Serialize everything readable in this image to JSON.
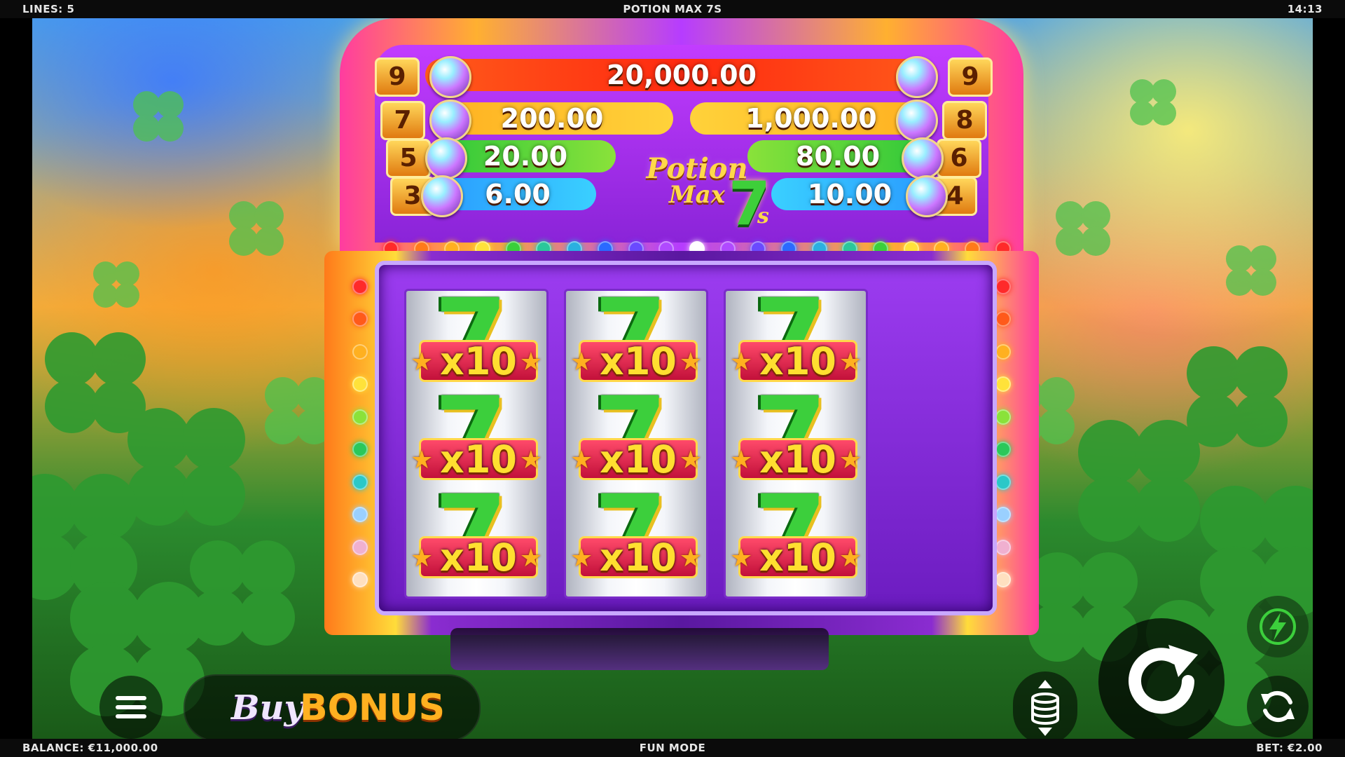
{
  "status_bar": {
    "lines_label": "LINES: 5",
    "game_title": "POTION MAX 7S",
    "clock": "14:13",
    "balance": "BALANCE: €11,000.00",
    "mode": "FUN MODE",
    "bet": "BET: €2.00"
  },
  "paytable": {
    "rows": [
      {
        "left_count": "9",
        "right_count": "9",
        "center_value": "20,000.00"
      },
      {
        "left_count": "7",
        "left_value": "200.00",
        "right_value": "1,000.00",
        "right_count": "8"
      },
      {
        "left_count": "5",
        "left_value": "20.00",
        "right_value": "80.00",
        "right_count": "6"
      },
      {
        "left_count": "3",
        "left_value": "6.00",
        "right_value": "10.00",
        "right_count": "4"
      }
    ]
  },
  "logo": {
    "line1": "Potion",
    "line2": "Max",
    "seven": "7",
    "suffix": "s"
  },
  "reels": {
    "symbol_multiplier": "x10",
    "grid": [
      [
        "x10",
        "x10",
        "x10"
      ],
      [
        "x10",
        "x10",
        "x10"
      ],
      [
        "x10",
        "x10",
        "x10"
      ]
    ]
  },
  "controls": {
    "buy_label": "Buy",
    "bonus_label": "BONUS"
  },
  "colors": {
    "accent_orange": "#ffb020",
    "seven_green": "#3ccf3c",
    "cabinet_purple": "#6c1cc0",
    "multiplier_red": "#c2103a"
  },
  "icons": {
    "menu": "hamburger-icon",
    "coins": "coin-stack-icon",
    "spin": "spin-arrow-icon",
    "turbo": "lightning-icon",
    "autoplay": "autoplay-icon"
  }
}
